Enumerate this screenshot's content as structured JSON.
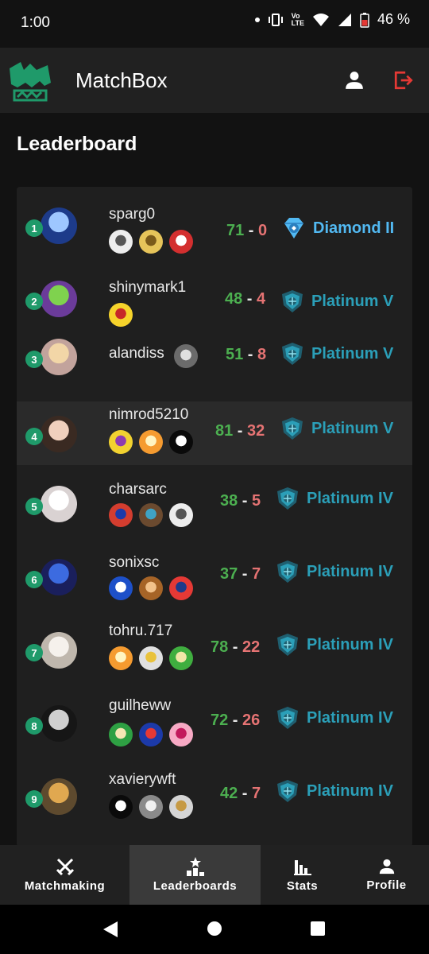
{
  "status": {
    "time": "1:00",
    "battery": "46 %",
    "net_top": "Vo",
    "net_bottom": "LTE"
  },
  "app": {
    "title": "MatchBox"
  },
  "page": {
    "title": "Leaderboard"
  },
  "leaderboard": [
    {
      "rank": "1",
      "username": "sparg0",
      "wins": "71",
      "losses": "0",
      "tier": "Diamond II",
      "chars": [
        "white",
        "gold",
        "redwhite"
      ]
    },
    {
      "rank": "2",
      "username": "shinymark1",
      "wins": "48",
      "losses": "4",
      "tier": "Platinum V",
      "chars": [
        "pikachu"
      ]
    },
    {
      "rank": "3",
      "username": "alandiss",
      "wins": "51",
      "losses": "8",
      "tier": "Platinum V",
      "chars": [
        "snake"
      ]
    },
    {
      "rank": "4",
      "username": "nimrod5210",
      "wins": "81",
      "losses": "32",
      "tier": "Platinum V",
      "chars": [
        "wario",
        "daisy",
        "black"
      ]
    },
    {
      "rank": "5",
      "username": "charsarc",
      "wins": "38",
      "losses": "5",
      "tier": "Platinum IV",
      "chars": [
        "dedede",
        "steve",
        "white"
      ]
    },
    {
      "rank": "6",
      "username": "sonixsc",
      "wins": "37",
      "losses": "7",
      "tier": "Platinum IV",
      "chars": [
        "sonic",
        "dk",
        "roy"
      ]
    },
    {
      "rank": "7",
      "username": "tohru.717",
      "wins": "78",
      "losses": "22",
      "tier": "Platinum IV",
      "chars": [
        "daisy",
        "ice",
        "bowserjr"
      ]
    },
    {
      "rank": "8",
      "username": "guilheww",
      "wins": "72",
      "losses": "26",
      "tier": "Platinum IV",
      "chars": [
        "palutena",
        "greninja",
        "kirby"
      ]
    },
    {
      "rank": "9",
      "username": "xavierywft",
      "wins": "42",
      "losses": "7",
      "tier": "Platinum IV",
      "chars": [
        "black",
        "gray",
        "sword"
      ]
    }
  ],
  "nav": {
    "matchmaking": "Matchmaking",
    "leaderboards": "Leaderboards",
    "stats": "Stats",
    "profile": "Profile"
  },
  "colors": {
    "accent": "#1f9a6a",
    "wins": "#4caf50",
    "losses": "#e57373",
    "platinum": "#2b9fb8",
    "diamond": "#52b9f2",
    "logout": "#e53935"
  }
}
